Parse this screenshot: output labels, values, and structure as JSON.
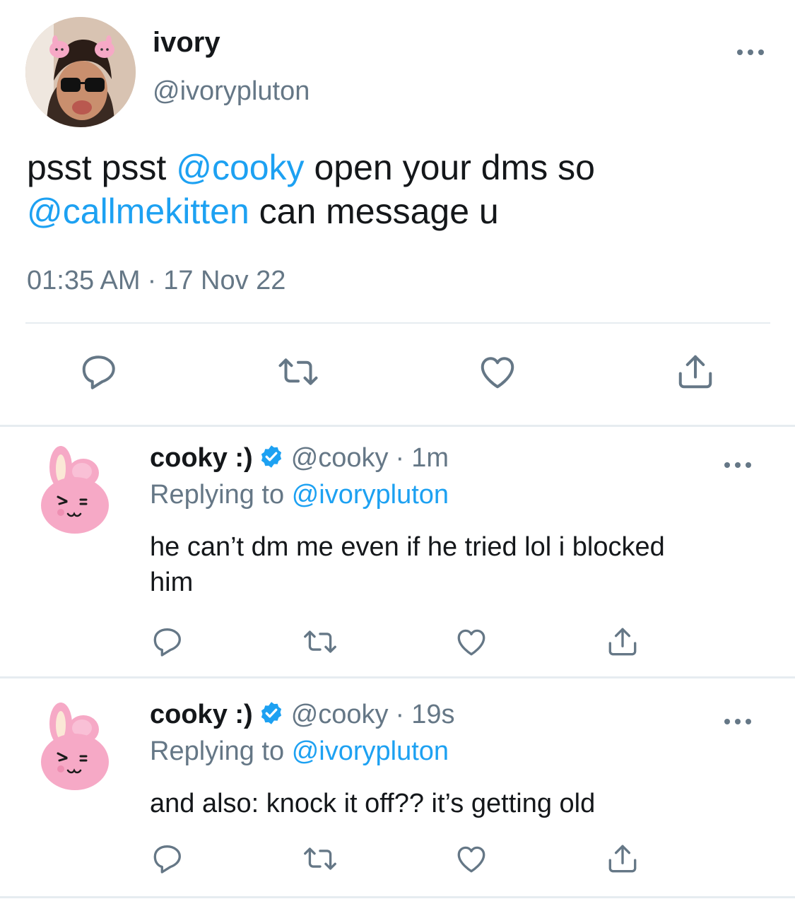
{
  "main_tweet": {
    "display_name": "ivory",
    "handle": "@ivorypluton",
    "text_parts": [
      {
        "text": "psst psst ",
        "mention": false
      },
      {
        "text": "@cooky",
        "mention": true
      },
      {
        "text": " open your dms so ",
        "mention": false
      },
      {
        "text": "@callmekitten",
        "mention": true
      },
      {
        "text": " can message u",
        "mention": false
      }
    ],
    "time": "01:35 AM",
    "separator": "·",
    "date": "17 Nov 22",
    "avatar_icon": "user-avatar-photo",
    "more_icon": "more-dots-icon"
  },
  "replies": [
    {
      "display_name": "cooky :)",
      "handle": "@cooky",
      "separator": "·",
      "age": "1m",
      "replying_label": "Replying to",
      "replying_handle": "@ivorypluton",
      "text": "he can’t dm me even if he tried lol i blocked him",
      "avatar_icon": "pink-bunny-avatar"
    },
    {
      "display_name": "cooky :)",
      "handle": "@cooky",
      "separator": "·",
      "age": "19s",
      "replying_label": "Replying to",
      "replying_handle": "@ivorypluton",
      "text": "and also: knock it off?? it’s getting old",
      "avatar_icon": "pink-bunny-avatar"
    }
  ],
  "action_icons": [
    "reply-icon",
    "retweet-icon",
    "like-icon",
    "share-icon"
  ],
  "colors": {
    "accent": "#1da1f2",
    "text": "#14171a",
    "secondary": "#657786",
    "icon": "#657786",
    "divider": "#e6ecf0",
    "bunny_pink": "#f6a9c6"
  }
}
